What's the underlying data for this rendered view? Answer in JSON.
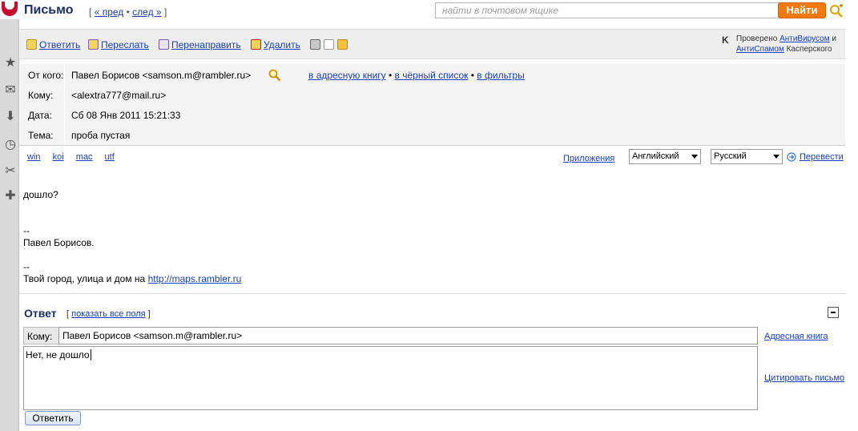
{
  "header": {
    "title": "Письмо",
    "nav_open": "[",
    "nav_prev": "« пред",
    "nav_dot": "•",
    "nav_next": "след »",
    "nav_close": "]",
    "search_placeholder": "найти в почтовом ящике",
    "find_button": "Найти"
  },
  "toolbar": {
    "reply": "Ответить",
    "forward": "Переслать",
    "redirect": "Перенаправить",
    "delete": "Удалить",
    "kaspersky_prefix": "Проверено",
    "kaspersky_antivirus": "АнтиВирусом",
    "kaspersky_and": "и",
    "kaspersky_antispam": "АнтиСпамом",
    "kaspersky_suffix": "Касперского"
  },
  "message": {
    "from_label": "От кого:",
    "from_value": "Павел Борисов <samson.m@rambler.ru>",
    "add_to_addressbook": "в адресную книгу",
    "add_to_blacklist": "в чёрный список",
    "add_to_filters": "в фильтры",
    "bullet": "•",
    "to_label": "Кому:",
    "to_value": "<alextra777@mail.ru>",
    "date_label": "Дата:",
    "date_value": "Сб 08 Янв 2011 15:21:33",
    "subject_label": "Тема:",
    "subject_value": "проба пустая"
  },
  "encodings": [
    "win",
    "koi",
    "mac",
    "utf"
  ],
  "translate": {
    "apps": "Приложения",
    "from_lang": "Английский",
    "to_lang": "Русский",
    "translate_link": "Перевести"
  },
  "body": {
    "line1": "дошло?",
    "sig1_sep": "--",
    "sig1_name": "Павел Борисов.",
    "sig2_sep": "--",
    "sig2_text": "Твой город, улица и дом на ",
    "sig2_link": "http://maps.rambler.ru"
  },
  "reply": {
    "title": "Ответ",
    "show_all_open": "[",
    "show_all": "показать все поля",
    "show_all_close": "]",
    "to_label": "Кому:",
    "to_value": "Павел Борисов <samson.m@rambler.ru>",
    "address_book": "Адресная книга",
    "text": "Нет, не дошло",
    "cite": "Цитировать письмо",
    "send": "Ответить"
  }
}
